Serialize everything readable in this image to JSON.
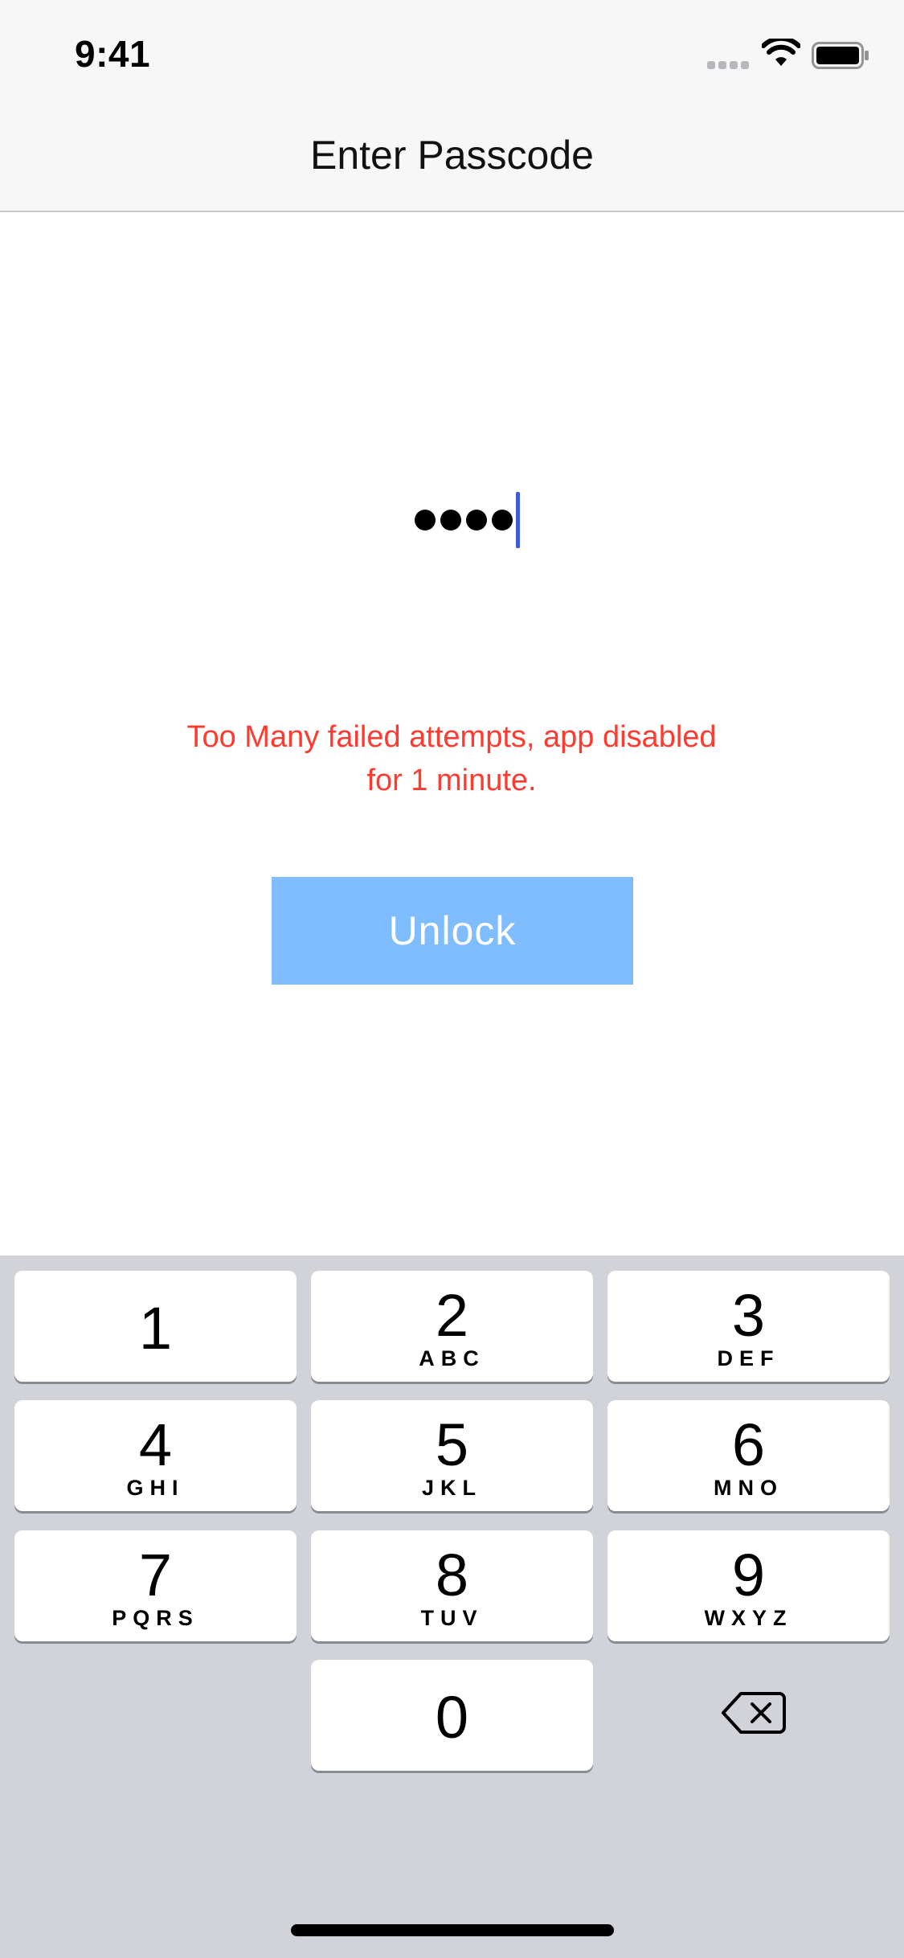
{
  "status_bar": {
    "time": "9:41",
    "signal_icon": "signal-icon",
    "wifi_icon": "wifi-icon",
    "battery_icon": "battery-icon"
  },
  "nav": {
    "title": "Enter Passcode"
  },
  "passcode": {
    "masked_value": "••••",
    "digit_count": 4
  },
  "error": {
    "message": "Too Many failed attempts, app disabled for 1 minute."
  },
  "unlock_button": {
    "label": "Unlock",
    "color": "#7fbdff"
  },
  "keypad": {
    "keys": [
      {
        "digit": "1",
        "letters": ""
      },
      {
        "digit": "2",
        "letters": "ABC"
      },
      {
        "digit": "3",
        "letters": "DEF"
      },
      {
        "digit": "4",
        "letters": "GHI"
      },
      {
        "digit": "5",
        "letters": "JKL"
      },
      {
        "digit": "6",
        "letters": "MNO"
      },
      {
        "digit": "7",
        "letters": "PQRS"
      },
      {
        "digit": "8",
        "letters": "TUV"
      },
      {
        "digit": "9",
        "letters": "WXYZ"
      },
      {
        "digit": "0",
        "letters": ""
      }
    ],
    "delete_icon": "delete-backspace-icon"
  },
  "colors": {
    "error": "#ff3b30",
    "caret": "#3e5bdc",
    "keypad_bg": "#d1d3d9"
  }
}
